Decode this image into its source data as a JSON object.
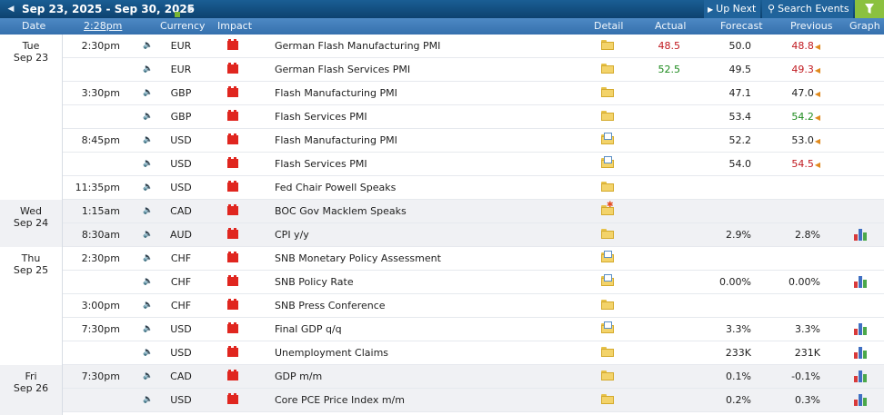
{
  "toolbar": {
    "date_range": "Sep 23, 2025 - Sep 30, 2025",
    "up_next_label": "Up Next",
    "search_label": "Search Events"
  },
  "columns": {
    "date": "Date",
    "time": "2:28pm",
    "currency": "Currency",
    "impact": "Impact",
    "detail": "Detail",
    "actual": "Actual",
    "forecast": "Forecast",
    "previous": "Previous",
    "graph": "Graph"
  },
  "colors": {
    "header_bg": "#0f4a7b",
    "column_header_bg": "#3b7ab8",
    "impact_high": "#e0261f",
    "better_than_expected": "#1d8a1d",
    "worse_than_expected": "#c0191f",
    "filter_button": "#8bc13f"
  },
  "days": [
    {
      "weekday": "Tue",
      "date": "Sep 23"
    },
    {
      "weekday": "Wed",
      "date": "Sep 24"
    },
    {
      "weekday": "Thu",
      "date": "Sep 25"
    },
    {
      "weekday": "Fri",
      "date": "Sep 26"
    }
  ],
  "events": [
    {
      "time": "2:30pm",
      "currency": "EUR",
      "event": "German Flash Manufacturing PMI",
      "actual": "48.5",
      "actual_color": "red",
      "forecast": "50.0",
      "previous": "48.8",
      "previous_color": "red",
      "revised": true,
      "graph": false,
      "detail_icon": "folder-icon"
    },
    {
      "time": "",
      "currency": "EUR",
      "event": "German Flash Services PMI",
      "actual": "52.5",
      "actual_color": "green",
      "forecast": "49.5",
      "previous": "49.3",
      "previous_color": "red",
      "revised": true,
      "graph": false,
      "detail_icon": "folder-icon"
    },
    {
      "time": "3:30pm",
      "currency": "GBP",
      "event": "Flash Manufacturing PMI",
      "actual": "",
      "forecast": "47.1",
      "previous": "47.0",
      "previous_color": "",
      "revised": true,
      "graph": false,
      "detail_icon": "folder-icon"
    },
    {
      "time": "",
      "currency": "GBP",
      "event": "Flash Services PMI",
      "actual": "",
      "forecast": "53.4",
      "previous": "54.2",
      "previous_color": "green",
      "revised": true,
      "graph": false,
      "detail_icon": "folder-icon"
    },
    {
      "time": "8:45pm",
      "currency": "USD",
      "event": "Flash Manufacturing PMI",
      "actual": "",
      "forecast": "52.2",
      "previous": "53.0",
      "previous_color": "",
      "revised": true,
      "graph": false,
      "detail_icon": "folder-doc-icon"
    },
    {
      "time": "",
      "currency": "USD",
      "event": "Flash Services PMI",
      "actual": "",
      "forecast": "54.0",
      "previous": "54.5",
      "previous_color": "red",
      "revised": true,
      "graph": false,
      "detail_icon": "folder-doc-icon"
    },
    {
      "time": "11:35pm",
      "currency": "USD",
      "event": "Fed Chair Powell Speaks",
      "actual": "",
      "forecast": "",
      "previous": "",
      "previous_color": "",
      "revised": false,
      "graph": false,
      "detail_icon": "folder-icon"
    },
    {
      "time": "1:15am",
      "currency": "CAD",
      "event": "BOC Gov Macklem Speaks",
      "actual": "",
      "forecast": "",
      "previous": "",
      "previous_color": "",
      "revised": false,
      "graph": false,
      "detail_icon": "folder-star-icon"
    },
    {
      "time": "8:30am",
      "currency": "AUD",
      "event": "CPI y/y",
      "actual": "",
      "forecast": "2.9%",
      "previous": "2.8%",
      "previous_color": "",
      "revised": false,
      "graph": true,
      "detail_icon": "folder-icon"
    },
    {
      "time": "2:30pm",
      "currency": "CHF",
      "event": "SNB Monetary Policy Assessment",
      "actual": "",
      "forecast": "",
      "previous": "",
      "previous_color": "",
      "revised": false,
      "graph": false,
      "detail_icon": "folder-doc-icon"
    },
    {
      "time": "",
      "currency": "CHF",
      "event": "SNB Policy Rate",
      "actual": "",
      "forecast": "0.00%",
      "previous": "0.00%",
      "previous_color": "",
      "revised": false,
      "graph": true,
      "detail_icon": "folder-doc-icon"
    },
    {
      "time": "3:00pm",
      "currency": "CHF",
      "event": "SNB Press Conference",
      "actual": "",
      "forecast": "",
      "previous": "",
      "previous_color": "",
      "revised": false,
      "graph": false,
      "detail_icon": "folder-icon"
    },
    {
      "time": "7:30pm",
      "currency": "USD",
      "event": "Final GDP q/q",
      "actual": "",
      "forecast": "3.3%",
      "previous": "3.3%",
      "previous_color": "",
      "revised": false,
      "graph": true,
      "detail_icon": "folder-doc-icon"
    },
    {
      "time": "",
      "currency": "USD",
      "event": "Unemployment Claims",
      "actual": "",
      "forecast": "233K",
      "previous": "231K",
      "previous_color": "",
      "revised": false,
      "graph": true,
      "detail_icon": "folder-icon"
    },
    {
      "time": "7:30pm",
      "currency": "CAD",
      "event": "GDP m/m",
      "actual": "",
      "forecast": "0.1%",
      "previous": "-0.1%",
      "previous_color": "",
      "revised": false,
      "graph": true,
      "detail_icon": "folder-icon"
    },
    {
      "time": "",
      "currency": "USD",
      "event": "Core PCE Price Index m/m",
      "actual": "",
      "forecast": "0.2%",
      "previous": "0.3%",
      "previous_color": "",
      "revised": false,
      "graph": true,
      "detail_icon": "folder-icon"
    }
  ]
}
